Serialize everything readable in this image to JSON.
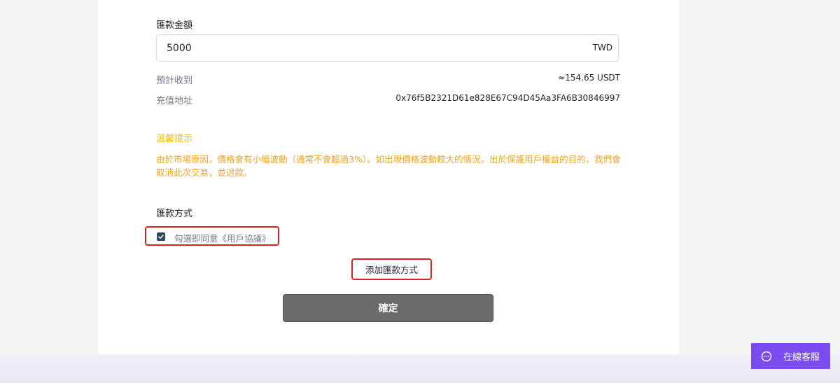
{
  "amount": {
    "label": "匯款金額",
    "value": "5000",
    "currency": "TWD"
  },
  "expected": {
    "label": "預計收到",
    "value": "≈154.65 USDT"
  },
  "address": {
    "label": "充值地址",
    "value": "0x76f5B2321D61e828E67C94D45Aa3FA6B30846997"
  },
  "tip": {
    "title": "溫馨提示",
    "text": "由於市場原因，價格會有小幅波動（通常不會超過3%）。如出現價格波動較大的情況，出於保護用戶權益的目的，我們會取消此次交易，並退款。"
  },
  "payment_method": {
    "label": "匯款方式",
    "agreement_text": "勾選即同意《用戶協議》",
    "agreement_checked": true,
    "add_method_label": "添加匯款方式"
  },
  "confirm_label": "確定",
  "chat": {
    "label": "在線客服",
    "icon": "chat-bubble-icon"
  },
  "colors": {
    "tip": "#f0b90b",
    "checkbox": "#2e4a5c",
    "highlight_border": "#e0201e",
    "confirm_bg": "#6b6b6b",
    "chat_bg": "#7a4cf0"
  }
}
